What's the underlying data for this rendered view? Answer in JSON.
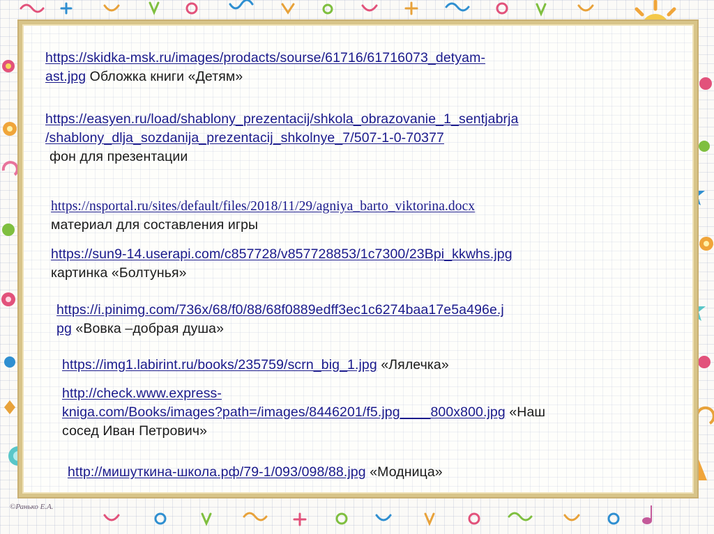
{
  "entries": [
    {
      "url_line1": "https://skidka-msk.ru/images/prodacts/sourse/61716/61716073_detyam-",
      "url_line2": "ast.jpg",
      "caption": " Обложка  книги «Детям»"
    },
    {
      "url_line1": "https://easyen.ru/load/shablony_prezentacij/shkola_obrazovanie_1_sentjabrja",
      "url_line2": "/shablony_dlja_sozdanija_prezentacij_shkolnye_7/507-1-0-70377",
      "caption": "фон для презентации"
    },
    {
      "url": "https://nsportal.ru/sites/default/files/2018/11/29/agniya_barto_viktorina.docx",
      "caption": "материал для составления игры"
    },
    {
      "url": "https://sun9-14.userapi.com/c857728/v857728853/1c7300/23Bpi_kkwhs.jpg",
      "caption": "картинка «Болтунья»"
    },
    {
      "url_line1": "https://i.pinimg.com/736x/68/f0/88/68f0889edff3ec1c6274baa17e5a496e.j",
      "url_line2": "pg",
      "caption": " «Вовка –добрая душа»"
    },
    {
      "url": "https://img1.labirint.ru/books/235759/scrn_big_1.jpg",
      "caption": "  «Лялечка»"
    },
    {
      "url_line1": "http://check.www.express-",
      "url_line2": "kniga.com/Books/images?path=/images/8446201/f5.jpg____800x800.jpg",
      "caption_line1": " «Наш",
      "caption_line2": "сосед Иван Петрович»"
    },
    {
      "url": "http://мишуткина-школа.рф/79-1/093/098/88.jpg",
      "caption": "  «Модница»"
    }
  ],
  "copyright": "©Ранько Е.А.",
  "colors": {
    "link": "#1a1a8c",
    "frame": "#d8c489",
    "text": "#1a1a1a"
  }
}
